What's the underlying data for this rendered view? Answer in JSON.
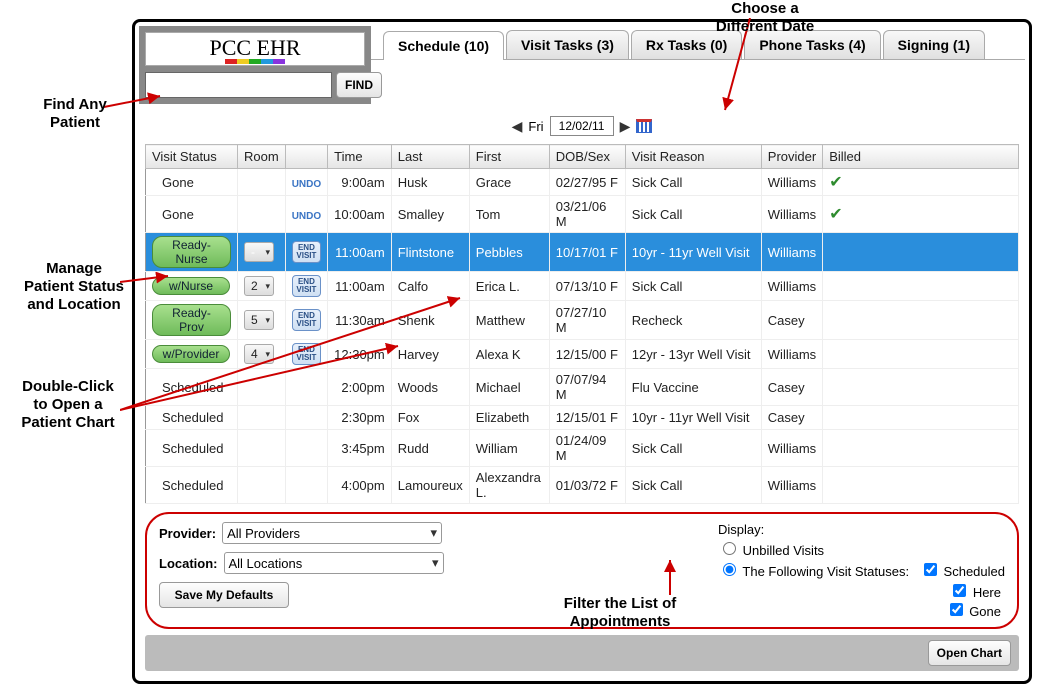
{
  "logo_text": "PCC EHR",
  "find_button": "FIND",
  "tabs": [
    {
      "label": "Schedule (10)",
      "active": true
    },
    {
      "label": "Visit Tasks (3)"
    },
    {
      "label": "Rx Tasks (0)"
    },
    {
      "label": "Phone Tasks (4)"
    },
    {
      "label": "Signing (1)"
    }
  ],
  "date": {
    "dow": "Fri",
    "value": "12/02/11"
  },
  "columns": [
    "Visit Status",
    "Room",
    "",
    "Time",
    "Last",
    "First",
    "DOB/Sex",
    "Visit Reason",
    "Provider",
    "Billed"
  ],
  "rows": [
    {
      "status": "Gone",
      "status_type": "text",
      "undo": true,
      "time": "9:00am",
      "last": "Husk",
      "first": "Grace",
      "dob": "02/27/95 F",
      "reason": "Sick Call",
      "provider": "Williams",
      "billed": true
    },
    {
      "status": "Gone",
      "status_type": "text",
      "undo": true,
      "time": "10:00am",
      "last": "Smalley",
      "first": "Tom",
      "dob": "03/21/06 M",
      "reason": "Sick Call",
      "provider": "Williams",
      "billed": true
    },
    {
      "status": "Ready-Nurse",
      "status_type": "pill",
      "room": "-",
      "endvisit": true,
      "time": "11:00am",
      "last": "Flintstone",
      "first": "Pebbles",
      "dob": "10/17/01 F",
      "reason": "10yr - 11yr Well Visit",
      "provider": "Williams",
      "selected": true
    },
    {
      "status": "w/Nurse",
      "status_type": "pill",
      "room": "2",
      "endvisit": true,
      "time": "11:00am",
      "last": "Calfo",
      "first": "Erica L.",
      "dob": "07/13/10 F",
      "reason": "Sick Call",
      "provider": "Williams"
    },
    {
      "status": "Ready-Prov",
      "status_type": "pill",
      "room": "5",
      "endvisit": true,
      "time": "11:30am",
      "last": "Shenk",
      "first": "Matthew",
      "dob": "07/27/10 M",
      "reason": "Recheck",
      "provider": "Casey"
    },
    {
      "status": "w/Provider",
      "status_type": "pill",
      "room": "4",
      "endvisit": true,
      "time": "12:30pm",
      "last": "Harvey",
      "first": "Alexa K",
      "dob": "12/15/00 F",
      "reason": "12yr - 13yr Well Visit",
      "provider": "Williams"
    },
    {
      "status": "Scheduled",
      "status_type": "text",
      "time": "2:00pm",
      "last": "Woods",
      "first": "Michael",
      "dob": "07/07/94 M",
      "reason": "Flu Vaccine",
      "provider": "Casey"
    },
    {
      "status": "Scheduled",
      "status_type": "text",
      "time": "2:30pm",
      "last": "Fox",
      "first": "Elizabeth",
      "dob": "12/15/01 F",
      "reason": "10yr - 11yr Well Visit",
      "provider": "Casey"
    },
    {
      "status": "Scheduled",
      "status_type": "text",
      "time": "3:45pm",
      "last": "Rudd",
      "first": "William",
      "dob": "01/24/09 M",
      "reason": "Sick Call",
      "provider": "Williams"
    },
    {
      "status": "Scheduled",
      "status_type": "text",
      "time": "4:00pm",
      "last": "Lamoureux",
      "first": "Alexzandra L.",
      "dob": "01/03/72 F",
      "reason": "Sick Call",
      "provider": "Williams"
    }
  ],
  "filters": {
    "provider_label": "Provider:",
    "provider_value": "All Providers",
    "location_label": "Location:",
    "location_value": "All Locations",
    "save_defaults": "Save My Defaults",
    "display_label": "Display:",
    "opt_unbilled": "Unbilled Visits",
    "opt_statuses": "The Following Visit Statuses:",
    "chk_scheduled": "Scheduled",
    "chk_here": "Here",
    "chk_gone": "Gone"
  },
  "open_chart": "Open Chart",
  "annotations": {
    "choose_date": "Choose a\nDifferent Date",
    "find_patient": "Find Any\nPatient",
    "manage_status": "Manage\nPatient Status\nand Location",
    "dbl_click": "Double-Click\nto Open a\nPatient Chart",
    "filter_list": "Filter the List of\nAppointments",
    "undo": "UNDO",
    "end_visit": "END\nVISIT"
  }
}
